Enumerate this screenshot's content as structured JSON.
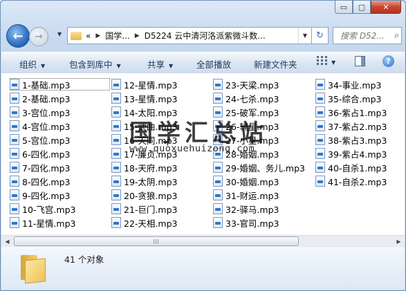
{
  "window": {
    "caption_buttons": {
      "minimize": "▭",
      "maximize": "▢",
      "close": "✕"
    }
  },
  "nav": {
    "address_segments": [
      "«",
      "国学...",
      "D5224 云中清河洛派紫微斗数..."
    ],
    "search_placeholder": "搜索 D52...",
    "refresh_glyph": "↻",
    "search_glyph": "⌕"
  },
  "toolbar": {
    "organize": "组织",
    "include_in_library": "包含到库中",
    "share": "共享",
    "play_all": "全部播放",
    "new_folder": "新建文件夹",
    "help": "?"
  },
  "files": [
    "1-基础.mp3",
    "2-基础.mp3",
    "3-宫位.mp3",
    "4-宫位.mp3",
    "5-宫位.mp3",
    "6-四化.mp3",
    "7-四化.mp3",
    "8-四化.mp3",
    "9-四化.mp3",
    "10-飞宫.mp3",
    "11-星情.mp3",
    "12-星情.mp3",
    "13-星情.mp3",
    "14-太阳.mp3",
    "15-武曲.mp3",
    "16-天同.mp3",
    "17-廉贞.mp3",
    "18-天府.mp3",
    "19-太阴.mp3",
    "20-贪狼.mp3",
    "21-巨门.mp3",
    "22-天相.mp3",
    "23-天梁.mp3",
    "24-七杀.mp3",
    "25-破军.mp3",
    "26-辅星.mp3",
    "27-小星.mp3",
    "28-婚姻.mp3",
    "29-婚姻、务儿.mp3",
    "30-婚姻.mp3",
    "31-财运.mp3",
    "32-驿马.mp3",
    "33-官司.mp3",
    "34-事业.mp3",
    "35-综合.mp3",
    "36-紫占1.mp3",
    "37-紫占2.mp3",
    "38-紫占3.mp3",
    "39-紫占4.mp3",
    "40-自杀1.mp3",
    "41-自杀2.mp3"
  ],
  "status": {
    "count_text": "41 个对象"
  },
  "watermark": {
    "title": "国学汇总站",
    "url": "www.quoxuehuizong.com"
  }
}
